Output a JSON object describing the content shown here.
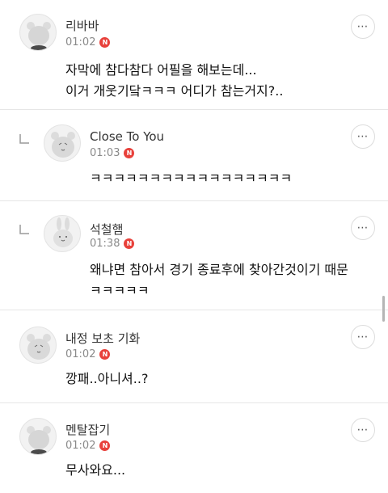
{
  "comments": [
    {
      "author": "리바바",
      "time": "01:02",
      "new_badge": "N",
      "text": "자막에 참다참다 어필을 해보는데...\n이거 개웃기닼ㅋㅋㅋ 어디가 참는거지?..",
      "is_reply": false,
      "avatar": "blank-bear-icon"
    },
    {
      "author": "Close To You",
      "time": "01:03",
      "new_badge": "N",
      "text": "ㅋㅋㅋㅋㅋㅋㅋㅋㅋㅋㅋㅋㅋㅋㅋㅋㅋ",
      "is_reply": true,
      "avatar": "bear-icon"
    },
    {
      "author": "석철햄",
      "time": "01:38",
      "new_badge": "N",
      "text": "왜냐면 참아서 경기 종료후에 찾아간것이기 때문\nㅋㅋㅋㅋㅋ",
      "is_reply": true,
      "avatar": "rabbit-icon"
    },
    {
      "author": "내정 보초 기화",
      "time": "01:02",
      "new_badge": "N",
      "text": "깡패..아니셔..?",
      "is_reply": false,
      "avatar": "bear-icon"
    },
    {
      "author": "멘탈잡기",
      "time": "01:02",
      "new_badge": "N",
      "text": "무사와요...",
      "is_reply": false,
      "avatar": "blank-bear-icon"
    }
  ],
  "more_button_label": "⋯",
  "colors": {
    "badge": "#e8413b",
    "divider": "#e6e6e6",
    "meta_text": "#8a8a8a"
  }
}
